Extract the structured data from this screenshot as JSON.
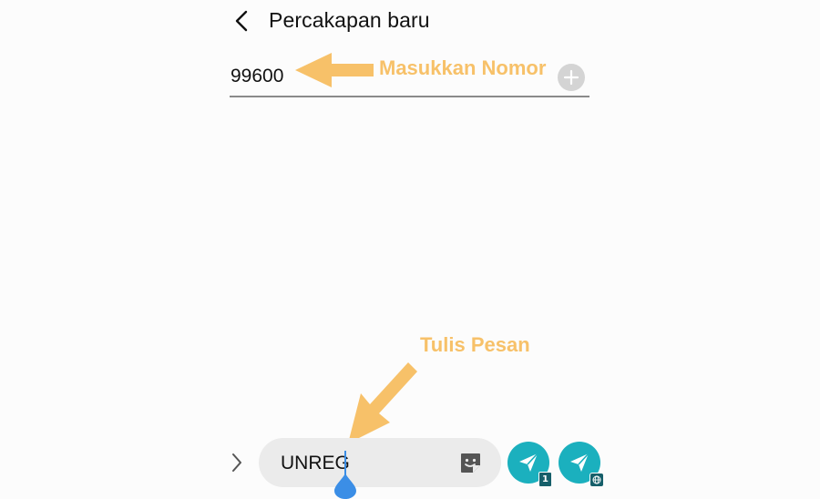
{
  "header": {
    "back_icon": "chevron-left-icon",
    "title": "Percakapan baru"
  },
  "recipient": {
    "value": "99600",
    "add_icon": "plus-circle-icon"
  },
  "annotations": {
    "number_label": "Masukkan Nomor",
    "message_label": "Tulis Pesan",
    "color": "#f7c169"
  },
  "composer": {
    "expand_icon": "chevron-right-icon",
    "message_value": "UNREG",
    "sticker_icon": "sticker-icon",
    "send_sim_badge": "1",
    "send_icon": "send-icon",
    "send_web_icon": "globe-icon",
    "accent_color": "#1bb0be"
  }
}
